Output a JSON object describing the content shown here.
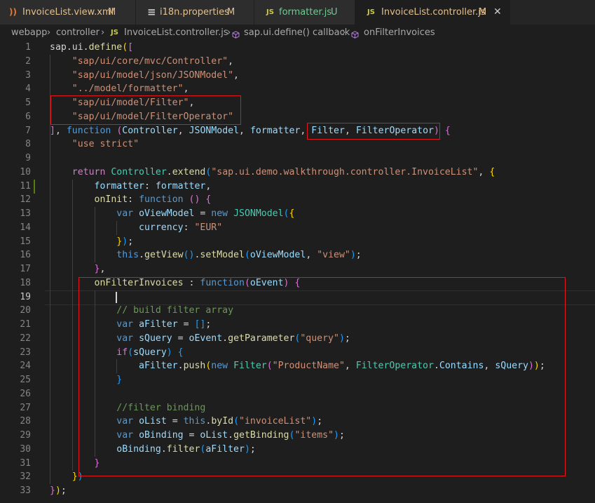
{
  "tabs": [
    {
      "label": "InvoiceList.view.xml",
      "status": "M",
      "icon": "rss-icon",
      "icon_glyph": "))",
      "icon_color": "#e37933",
      "label_color": "#e2c08d"
    },
    {
      "label": "i18n.properties",
      "status": "M",
      "icon": "list-icon",
      "icon_glyph": "≡",
      "icon_color": "#cccccc",
      "label_color": "#e2c08d"
    },
    {
      "label": "formatter.js",
      "status": "U",
      "icon": "javascript-icon",
      "icon_glyph": "JS",
      "icon_color": "#cbcb41",
      "label_color": "#73c991"
    },
    {
      "label": "InvoiceList.controller.js",
      "status": "M",
      "icon": "javascript-icon",
      "icon_glyph": "JS",
      "icon_color": "#cbcb41",
      "label_color": "#e2c08d",
      "close": "✕"
    }
  ],
  "breadcrumb": {
    "items": [
      "webapp",
      "controller",
      "InvoiceList.controller.js",
      "sap.ui.define() callback",
      "onFilterInvoices"
    ],
    "separator": "›",
    "js_badge": "JS"
  },
  "editor": {
    "line_numbers": [
      "1",
      "2",
      "3",
      "4",
      "5",
      "6",
      "7",
      "8",
      "9",
      "10",
      "11",
      "12",
      "13",
      "14",
      "15",
      "16",
      "17",
      "18",
      "19",
      "20",
      "21",
      "22",
      "23",
      "24",
      "25",
      "26",
      "27",
      "28",
      "29",
      "30",
      "31",
      "32",
      "33"
    ],
    "current_line": "19",
    "lines": [
      [
        [
          "p",
          "sap.ui."
        ],
        [
          "f",
          "define"
        ],
        [
          "b1",
          "("
        ],
        [
          "b2",
          "["
        ]
      ],
      [
        [
          "p",
          "    "
        ],
        [
          "s",
          "\"sap/ui/core/mvc/Controller\""
        ],
        [
          "p",
          ","
        ]
      ],
      [
        [
          "p",
          "    "
        ],
        [
          "s",
          "\"sap/ui/model/json/JSONModel\""
        ],
        [
          "p",
          ","
        ]
      ],
      [
        [
          "p",
          "    "
        ],
        [
          "s",
          "\"../model/formatter\""
        ],
        [
          "p",
          ","
        ]
      ],
      [
        [
          "p",
          "    "
        ],
        [
          "s",
          "\"sap/ui/model/Filter\""
        ],
        [
          "p",
          ","
        ]
      ],
      [
        [
          "p",
          "    "
        ],
        [
          "s",
          "\"sap/ui/model/FilterOperator\""
        ]
      ],
      [
        [
          "b2",
          "]"
        ],
        [
          "p",
          ", "
        ],
        [
          "k",
          "function"
        ],
        [
          "p",
          " "
        ],
        [
          "b2",
          "("
        ],
        [
          "v",
          "Controller"
        ],
        [
          "p",
          ", "
        ],
        [
          "v",
          "JSONModel"
        ],
        [
          "p",
          ", "
        ],
        [
          "v",
          "formatter"
        ],
        [
          "p",
          ", "
        ],
        [
          "v",
          "Filter"
        ],
        [
          "p",
          ", "
        ],
        [
          "v",
          "FilterOperator"
        ],
        [
          "b2",
          ")"
        ],
        [
          "p",
          " "
        ],
        [
          "b2",
          "{"
        ]
      ],
      [
        [
          "p",
          "    "
        ],
        [
          "s",
          "\"use strict\""
        ]
      ],
      [
        [
          "p",
          ""
        ]
      ],
      [
        [
          "p",
          "    "
        ],
        [
          "c",
          "return"
        ],
        [
          "p",
          " "
        ],
        [
          "t",
          "Controller"
        ],
        [
          "p",
          "."
        ],
        [
          "f",
          "extend"
        ],
        [
          "b3",
          "("
        ],
        [
          "s",
          "\"sap.ui.demo.walkthrough.controller.InvoiceList\""
        ],
        [
          "p",
          ", "
        ],
        [
          "b1",
          "{"
        ]
      ],
      [
        [
          "p",
          "        "
        ],
        [
          "v",
          "formatter"
        ],
        [
          "p",
          ": "
        ],
        [
          "v",
          "formatter"
        ],
        [
          "p",
          ","
        ]
      ],
      [
        [
          "p",
          "        "
        ],
        [
          "f",
          "onInit"
        ],
        [
          "p",
          ": "
        ],
        [
          "k",
          "function"
        ],
        [
          "p",
          " "
        ],
        [
          "b2",
          "()"
        ],
        [
          "p",
          " "
        ],
        [
          "b2",
          "{"
        ]
      ],
      [
        [
          "p",
          "            "
        ],
        [
          "k",
          "var"
        ],
        [
          "p",
          " "
        ],
        [
          "v",
          "oViewModel"
        ],
        [
          "p",
          " = "
        ],
        [
          "k",
          "new"
        ],
        [
          "p",
          " "
        ],
        [
          "t",
          "JSONModel"
        ],
        [
          "b3",
          "("
        ],
        [
          "b1",
          "{"
        ]
      ],
      [
        [
          "p",
          "                "
        ],
        [
          "v",
          "currency"
        ],
        [
          "p",
          ": "
        ],
        [
          "s",
          "\"EUR\""
        ]
      ],
      [
        [
          "p",
          "            "
        ],
        [
          "b1",
          "}"
        ],
        [
          "b3",
          ")"
        ],
        [
          "p",
          ";"
        ]
      ],
      [
        [
          "p",
          "            "
        ],
        [
          "k",
          "this"
        ],
        [
          "p",
          "."
        ],
        [
          "f",
          "getView"
        ],
        [
          "b3",
          "()"
        ],
        [
          "p",
          "."
        ],
        [
          "f",
          "setModel"
        ],
        [
          "b3",
          "("
        ],
        [
          "v",
          "oViewModel"
        ],
        [
          "p",
          ", "
        ],
        [
          "s",
          "\"view\""
        ],
        [
          "b3",
          ")"
        ],
        [
          "p",
          ";"
        ]
      ],
      [
        [
          "p",
          "        "
        ],
        [
          "b2",
          "}"
        ],
        [
          "p",
          ","
        ]
      ],
      [
        [
          "p",
          "        "
        ],
        [
          "f",
          "onFilterInvoices"
        ],
        [
          "p",
          " : "
        ],
        [
          "k",
          "function"
        ],
        [
          "b2",
          "("
        ],
        [
          "v",
          "oEvent"
        ],
        [
          "b2",
          ")"
        ],
        [
          "p",
          " "
        ],
        [
          "b2",
          "{"
        ]
      ],
      [
        [
          "p",
          ""
        ]
      ],
      [
        [
          "p",
          "            "
        ],
        [
          "g",
          "// build filter array"
        ]
      ],
      [
        [
          "p",
          "            "
        ],
        [
          "k",
          "var"
        ],
        [
          "p",
          " "
        ],
        [
          "v",
          "aFilter"
        ],
        [
          "p",
          " = "
        ],
        [
          "b3",
          "[]"
        ],
        [
          "p",
          ";"
        ]
      ],
      [
        [
          "p",
          "            "
        ],
        [
          "k",
          "var"
        ],
        [
          "p",
          " "
        ],
        [
          "v",
          "sQuery"
        ],
        [
          "p",
          " = "
        ],
        [
          "v",
          "oEvent"
        ],
        [
          "p",
          "."
        ],
        [
          "f",
          "getParameter"
        ],
        [
          "b3",
          "("
        ],
        [
          "s",
          "\"query\""
        ],
        [
          "b3",
          ")"
        ],
        [
          "p",
          ";"
        ]
      ],
      [
        [
          "p",
          "            "
        ],
        [
          "c",
          "if"
        ],
        [
          "b3",
          "("
        ],
        [
          "v",
          "sQuery"
        ],
        [
          "b3",
          ")"
        ],
        [
          "p",
          " "
        ],
        [
          "b3",
          "{"
        ]
      ],
      [
        [
          "p",
          "                "
        ],
        [
          "v",
          "aFilter"
        ],
        [
          "p",
          "."
        ],
        [
          "f",
          "push"
        ],
        [
          "b1",
          "("
        ],
        [
          "k",
          "new"
        ],
        [
          "p",
          " "
        ],
        [
          "t",
          "Filter"
        ],
        [
          "b2",
          "("
        ],
        [
          "s",
          "\"ProductName\""
        ],
        [
          "p",
          ", "
        ],
        [
          "t",
          "FilterOperator"
        ],
        [
          "p",
          "."
        ],
        [
          "v",
          "Contains"
        ],
        [
          "p",
          ", "
        ],
        [
          "v",
          "sQuery"
        ],
        [
          "b2",
          ")"
        ],
        [
          "b1",
          ")"
        ],
        [
          "p",
          ";"
        ]
      ],
      [
        [
          "p",
          "            "
        ],
        [
          "b3",
          "}"
        ]
      ],
      [
        [
          "p",
          ""
        ]
      ],
      [
        [
          "p",
          "            "
        ],
        [
          "g",
          "//filter binding"
        ]
      ],
      [
        [
          "p",
          "            "
        ],
        [
          "k",
          "var"
        ],
        [
          "p",
          " "
        ],
        [
          "v",
          "oList"
        ],
        [
          "p",
          " = "
        ],
        [
          "k",
          "this"
        ],
        [
          "p",
          "."
        ],
        [
          "f",
          "byId"
        ],
        [
          "b3",
          "("
        ],
        [
          "s",
          "\"invoiceList\""
        ],
        [
          "b3",
          ")"
        ],
        [
          "p",
          ";"
        ]
      ],
      [
        [
          "p",
          "            "
        ],
        [
          "k",
          "var"
        ],
        [
          "p",
          " "
        ],
        [
          "v",
          "oBinding"
        ],
        [
          "p",
          " = "
        ],
        [
          "v",
          "oList"
        ],
        [
          "p",
          "."
        ],
        [
          "f",
          "getBinding"
        ],
        [
          "b3",
          "("
        ],
        [
          "s",
          "\"items\""
        ],
        [
          "b3",
          ")"
        ],
        [
          "p",
          ";"
        ]
      ],
      [
        [
          "p",
          "            "
        ],
        [
          "v",
          "oBinding"
        ],
        [
          "p",
          "."
        ],
        [
          "f",
          "filter"
        ],
        [
          "b3",
          "("
        ],
        [
          "v",
          "aFilter"
        ],
        [
          "b3",
          ")"
        ],
        [
          "p",
          ";"
        ]
      ],
      [
        [
          "p",
          "        "
        ],
        [
          "b2",
          "}"
        ]
      ],
      [
        [
          "p",
          "    "
        ],
        [
          "b1",
          "}"
        ],
        [
          "b3",
          ")"
        ]
      ],
      [
        [
          "b2",
          "}"
        ],
        [
          "b1",
          ")"
        ],
        [
          "p",
          ";"
        ]
      ]
    ]
  }
}
